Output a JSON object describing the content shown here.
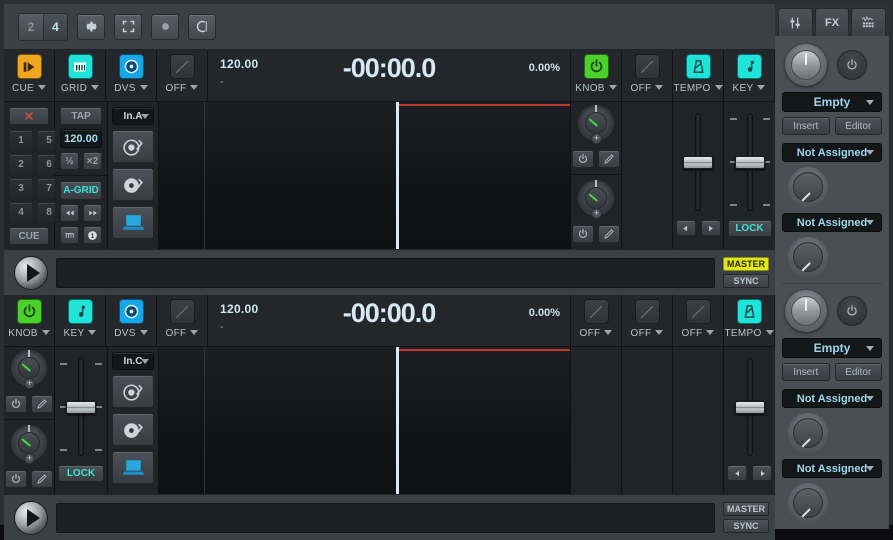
{
  "toolbar": {
    "deck_pair": {
      "options": [
        "2",
        "4"
      ],
      "selected": "4"
    },
    "buttons": [
      {
        "name": "preferences",
        "icon": "gear-icon"
      },
      {
        "name": "fullscreen",
        "icon": "fullscreen-icon"
      },
      {
        "name": "record",
        "icon": "record-icon"
      },
      {
        "name": "broadcast",
        "icon": "broadcast-icon"
      }
    ]
  },
  "right_panel": {
    "tabs": [
      {
        "label": "",
        "icon": "mixer-icon"
      },
      {
        "label": "FX",
        "icon": "fx-icon"
      },
      {
        "label": "",
        "icon": "sampler-icon"
      }
    ],
    "fx_units": [
      {
        "preset": "Empty",
        "insert_label": "Insert",
        "editor_label": "Editor",
        "slots": [
          "Not Assigned",
          "Not Assigned"
        ]
      },
      {
        "preset": "Empty",
        "insert_label": "Insert",
        "editor_label": "Editor",
        "slots": [
          "Not Assigned",
          "Not Assigned"
        ]
      }
    ]
  },
  "decks": [
    {
      "id": "A",
      "header_cells": [
        {
          "label": "CUE",
          "icon": "cue-play-icon",
          "state": "orange"
        },
        {
          "label": "GRID",
          "icon": "beatgrid-icon",
          "state": "cyan"
        },
        {
          "label": "DVS",
          "icon": "vinyl-disc-icon",
          "state": "blue"
        },
        {
          "label": "OFF",
          "icon": "slash-icon",
          "state": "off"
        }
      ],
      "right_cells": [
        {
          "label": "KNOB",
          "icon": "power-icon",
          "state": "green"
        },
        {
          "label": "OFF",
          "icon": "slash-icon",
          "state": "off"
        },
        {
          "label": "TEMPO",
          "icon": "metronome-icon",
          "state": "cyan"
        },
        {
          "label": "KEY",
          "icon": "note-icon",
          "state": "cyan"
        }
      ],
      "bpm": "120.00",
      "artist": "-",
      "time": "-00:00.0",
      "pitch": "0.00%",
      "hotcues": [
        "1",
        "5",
        "2",
        "6",
        "3",
        "7",
        "4",
        "8"
      ],
      "cue_label": "CUE",
      "clear_icon": "red-x-icon",
      "tap_label": "TAP",
      "tap_bpm": "120.00",
      "half_label": "½",
      "double_label": "×2",
      "grid_label": "A-GRID",
      "nudge_back_icon": "rewind-icon",
      "nudge_fwd_icon": "fastforward-icon",
      "grid_set_icon": "grid-set-icon",
      "grid_one_icon": "one-beat-icon",
      "input_source": "In.A",
      "source_buttons": [
        "turntable-icon",
        "cd-icon",
        "laptop-icon"
      ],
      "lock_label": "LOCK",
      "tempo_prev_icon": "left-arrow-icon",
      "tempo_next_icon": "right-arrow-icon",
      "master_label": "MASTER",
      "sync_label": "SYNC",
      "master_active": true,
      "play_icon": "play-icon"
    },
    {
      "id": "B",
      "header_cells": [
        {
          "label": "KNOB",
          "icon": "power-icon",
          "state": "green"
        },
        {
          "label": "KEY",
          "icon": "note-icon",
          "state": "cyan"
        },
        {
          "label": "DVS",
          "icon": "vinyl-disc-icon",
          "state": "blue"
        },
        {
          "label": "OFF",
          "icon": "slash-icon",
          "state": "off"
        }
      ],
      "right_cells": [
        {
          "label": "OFF",
          "icon": "slash-icon",
          "state": "off"
        },
        {
          "label": "OFF",
          "icon": "slash-icon",
          "state": "off"
        },
        {
          "label": "OFF",
          "icon": "slash-icon",
          "state": "off"
        },
        {
          "label": "TEMPO",
          "icon": "metronome-icon",
          "state": "cyan"
        }
      ],
      "bpm": "120.00",
      "artist": "-",
      "time": "-00:00.0",
      "pitch": "0.00%",
      "input_source": "In.C",
      "source_buttons": [
        "turntable-icon",
        "cd-icon",
        "laptop-icon"
      ],
      "lock_label": "LOCK",
      "tempo_prev_icon": "left-arrow-icon",
      "tempo_next_icon": "right-arrow-icon",
      "master_label": "MASTER",
      "sync_label": "SYNC",
      "master_active": false,
      "play_icon": "play-icon"
    }
  ],
  "colors": {
    "green": "#4ad22a",
    "cyan": "#1fe3d8",
    "blue": "#17a7e8",
    "orange": "#f0a61e",
    "master_yellow": "#e2e81a",
    "playhead": "#dde9f2",
    "progress_red": "#c0392b"
  }
}
